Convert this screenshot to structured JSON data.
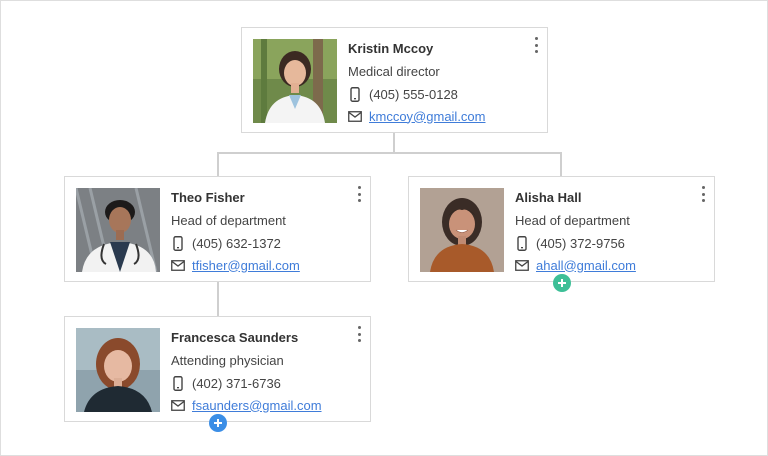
{
  "colors": {
    "link": "#3f7cd9",
    "add_green": "#3dbf97",
    "add_blue": "#3b8ee6",
    "connector": "#cfcfcf"
  },
  "icons": {
    "phone": "mobile-phone-icon",
    "email": "envelope-icon",
    "menu": "more-vertical-icon",
    "add": "plus-circle-icon"
  },
  "cards": [
    {
      "id": "kmccoy",
      "name": "Kristin Mccoy",
      "title": "Medical director",
      "phone": "(405) 555-0128",
      "email": "kmccoy@gmail.com"
    },
    {
      "id": "tfisher",
      "name": "Theo Fisher",
      "title": "Head of department",
      "phone": "(405) 632-1372",
      "email": "tfisher@gmail.com"
    },
    {
      "id": "ahall",
      "name": "Alisha Hall",
      "title": "Head of department",
      "phone": "(405) 372-9756",
      "email": "ahall@gmail.com"
    },
    {
      "id": "fsaunders",
      "name": "Francesca Saunders",
      "title": "Attending physician",
      "phone": "(402) 371-6736",
      "email": "fsaunders@gmail.com"
    }
  ]
}
